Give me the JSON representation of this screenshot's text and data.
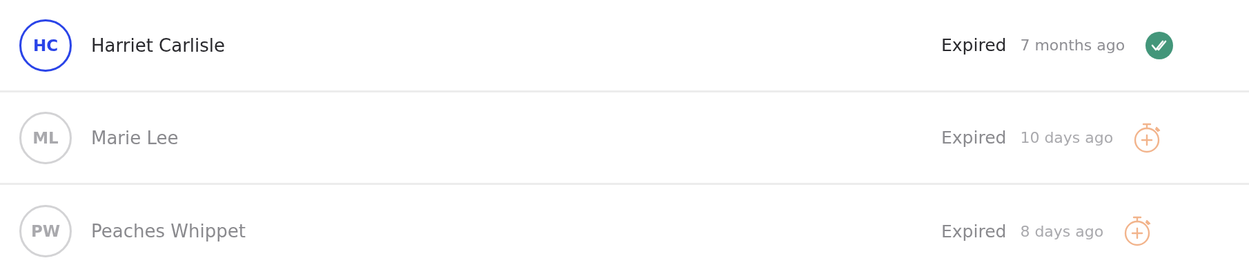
{
  "rows": [
    {
      "initials": "HC",
      "name": "Harriet Carlisle",
      "active": true,
      "status": "Expired",
      "time": "7 months ago",
      "kind": "completed"
    },
    {
      "initials": "ML",
      "name": "Marie Lee",
      "active": false,
      "status": "Expired",
      "time": "10 days ago",
      "kind": "timer"
    },
    {
      "initials": "PW",
      "name": "Peaches Whippet",
      "active": false,
      "status": "Expired",
      "time": "8 days ago",
      "kind": "timer"
    }
  ]
}
